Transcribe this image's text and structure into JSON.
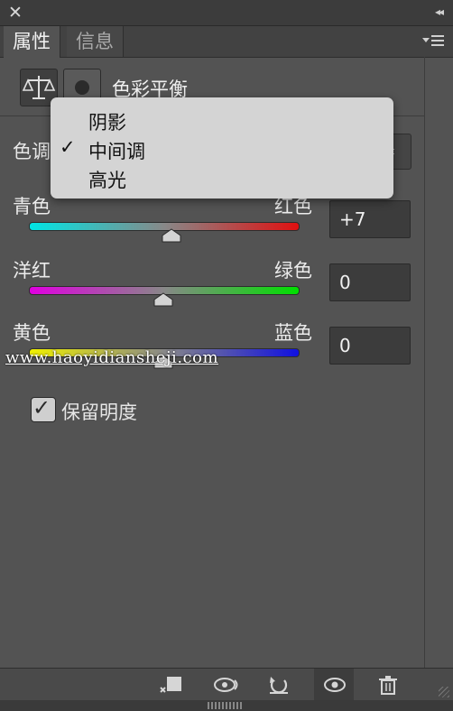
{
  "window": {
    "close_symbol": "✕",
    "collapse_symbol": "◂◂"
  },
  "tabs": [
    {
      "label": "属性",
      "active": true
    },
    {
      "label": "信息",
      "active": false
    }
  ],
  "header": {
    "icons": [
      "scale-icon",
      "mask-icon"
    ],
    "title": "色彩平衡"
  },
  "tone": {
    "label": "色调",
    "selected": "中间调",
    "options": [
      "阴影",
      "中间调",
      "高光"
    ]
  },
  "sliders": [
    {
      "left_label": "青色",
      "right_label": "红色",
      "value": "+7",
      "position": 0.53
    },
    {
      "left_label": "洋红",
      "right_label": "绿色",
      "value": "0",
      "position": 0.5
    },
    {
      "left_label": "黄色",
      "right_label": "蓝色",
      "value": "0",
      "position": 0.5
    }
  ],
  "preserve_luminosity": {
    "label": "保留明度",
    "checked": true
  },
  "watermark": "www.haoyidiansheji.com",
  "bottom_toolbar": [
    "clip-to-layer-icon",
    "view-previous-state-icon",
    "reset-icon",
    "visibility-eye-icon",
    "trash-icon"
  ],
  "colors": {
    "panel_bg": "#535353",
    "cyan": "#00e5e5",
    "red": "#e01010",
    "magenta": "#e000e0",
    "green": "#00e000",
    "yellow": "#f0f000",
    "blue": "#1010e0"
  }
}
